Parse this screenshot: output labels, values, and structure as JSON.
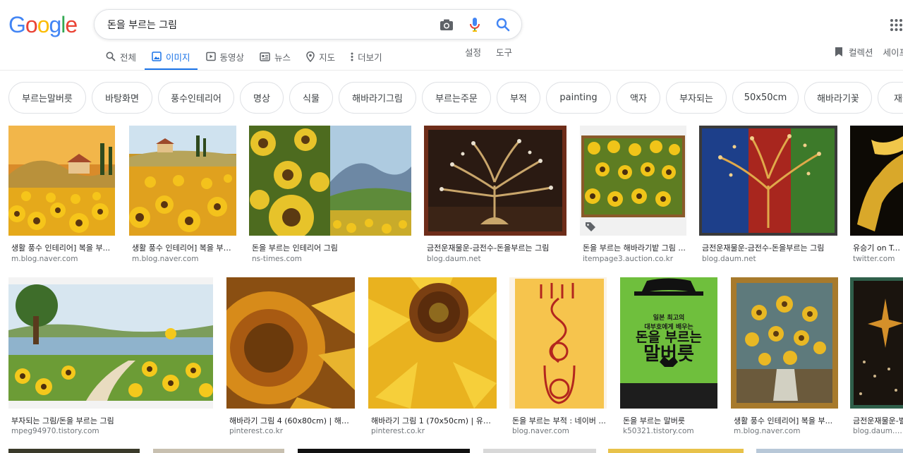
{
  "logo": {
    "letters": [
      "G",
      "o",
      "o",
      "g",
      "l",
      "e"
    ],
    "colors": [
      "#4285F4",
      "#EA4335",
      "#FBBC05",
      "#4285F4",
      "#34A853",
      "#EA4335"
    ]
  },
  "search": {
    "query": "돈을 부르는 그림"
  },
  "tabs": [
    {
      "label": "전체",
      "icon": "search-icon",
      "active": false
    },
    {
      "label": "이미지",
      "icon": "image-icon",
      "active": true
    },
    {
      "label": "동영상",
      "icon": "video-icon",
      "active": false
    },
    {
      "label": "뉴스",
      "icon": "news-icon",
      "active": false
    },
    {
      "label": "지도",
      "icon": "map-pin-icon",
      "active": false
    },
    {
      "label": "더보기",
      "icon": "more-vert-icon",
      "active": false
    }
  ],
  "tools": {
    "settings": "설정",
    "tools": "도구"
  },
  "collection": {
    "label": "컬렉션",
    "safe_search": "세이프"
  },
  "chips": [
    "부르는말버릇",
    "바탕화면",
    "풍수인테리어",
    "명상",
    "식물",
    "해바라기그림",
    "부르는주문",
    "부적",
    "painting",
    "액자",
    "부자되는",
    "50x50cm",
    "해바라기꽃",
    "재물"
  ],
  "results_row1": [
    {
      "caption": "생활 풍수 인테리어] 복을 부...",
      "source": "m.blog.naver.com"
    },
    {
      "caption": "생활 풍수 인테리어] 복을 부르...",
      "source": "m.blog.naver.com"
    },
    {
      "caption": "돈을 부르는 인테리어 그림",
      "source": "ns-times.com"
    },
    {
      "caption": "금전운재물운-금전수-돈을부르는 그림",
      "source": "blog.daum.net"
    },
    {
      "caption": "돈을 부르는 해바라기밭 그림 ...",
      "source": "itempage3.auction.co.kr"
    },
    {
      "caption": "금전운재물운-금전수-돈을부르는 그림",
      "source": "blog.daum.net"
    },
    {
      "caption": "유승기 on Twitt",
      "source": "twitter.com"
    }
  ],
  "results_row2": [
    {
      "caption": "부자되는 그림/돈을 부르는 그림",
      "source": "mpeg94970.tistory.com"
    },
    {
      "caption": "해바라기 그림 4 (60x80cm) | 해바...",
      "source": "pinterest.co.kr"
    },
    {
      "caption": "해바라기 그림 1 (70x50cm) | 유화,...",
      "source": "pinterest.co.kr"
    },
    {
      "caption": "돈을 부르는 부적 : 네이버 ...",
      "source": "blog.naver.com"
    },
    {
      "caption": "돈을 부르는 말버릇",
      "source": "k50321.tistory.com"
    },
    {
      "caption": "생활 풍수 인테리어] 복을 부...",
      "source": "m.blog.naver.com"
    },
    {
      "caption": "금전운재물운-벌",
      "source": "blog.daum.net"
    }
  ],
  "book_cover": {
    "line1": "일본 최고의",
    "line2": "대부호에게 배우는",
    "title1": "돈을 부르는",
    "title2": "말버릇"
  },
  "colors": {
    "accent": "#1a73e8",
    "chip_border": "#dfe1e5",
    "source": "#70757a"
  }
}
